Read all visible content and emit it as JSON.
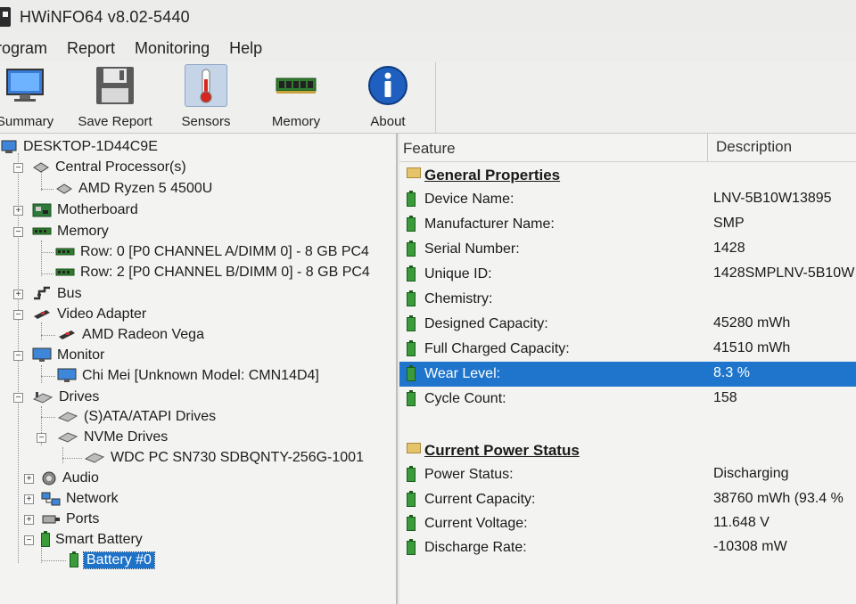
{
  "window": {
    "title": "HWiNFO64 v8.02-5440"
  },
  "menu": [
    "rogram",
    "Report",
    "Monitoring",
    "Help"
  ],
  "toolbar": {
    "summary": "Summary",
    "save_report": "Save Report",
    "sensors": "Sensors",
    "memory": "Memory",
    "about": "About"
  },
  "tree": {
    "root": "DESKTOP-1D44C9E",
    "cpu": "Central Processor(s)",
    "cpu_item": "AMD Ryzen 5 4500U",
    "motherboard": "Motherboard",
    "memory": "Memory",
    "mem_row0": "Row: 0 [P0 CHANNEL A/DIMM 0] - 8 GB PC4",
    "mem_row2": "Row: 2 [P0 CHANNEL B/DIMM 0] - 8 GB PC4",
    "bus": "Bus",
    "video": "Video Adapter",
    "video_item": "AMD Radeon Vega",
    "monitor": "Monitor",
    "monitor_item": "Chi Mei [Unknown Model: CMN14D4]",
    "drives": "Drives",
    "sata": "(S)ATA/ATAPI Drives",
    "nvme": "NVMe Drives",
    "nvme_item": "WDC PC SN730 SDBQNTY-256G-1001",
    "audio": "Audio",
    "network": "Network",
    "ports": "Ports",
    "smart_battery": "Smart Battery",
    "battery0": "Battery #0"
  },
  "list": {
    "header_feature": "Feature",
    "header_description": "Description",
    "general_title": "General Properties",
    "general": [
      {
        "name": "Device Name:",
        "value": "LNV-5B10W13895"
      },
      {
        "name": "Manufacturer Name:",
        "value": "SMP"
      },
      {
        "name": "Serial Number:",
        "value": "1428"
      },
      {
        "name": "Unique ID:",
        "value": "1428SMPLNV-5B10W"
      },
      {
        "name": "Chemistry:",
        "value": ""
      },
      {
        "name": "Designed Capacity:",
        "value": "45280 mWh"
      },
      {
        "name": "Full Charged Capacity:",
        "value": "41510 mWh"
      },
      {
        "name": "Wear Level:",
        "value": "8.3 %"
      },
      {
        "name": "Cycle Count:",
        "value": "158"
      }
    ],
    "power_title": "Current Power Status",
    "power": [
      {
        "name": "Power Status:",
        "value": "Discharging"
      },
      {
        "name": "Current Capacity:",
        "value": "38760 mWh (93.4 %"
      },
      {
        "name": "Current Voltage:",
        "value": "11.648 V"
      },
      {
        "name": "Discharge Rate:",
        "value": "-10308 mW"
      }
    ]
  }
}
